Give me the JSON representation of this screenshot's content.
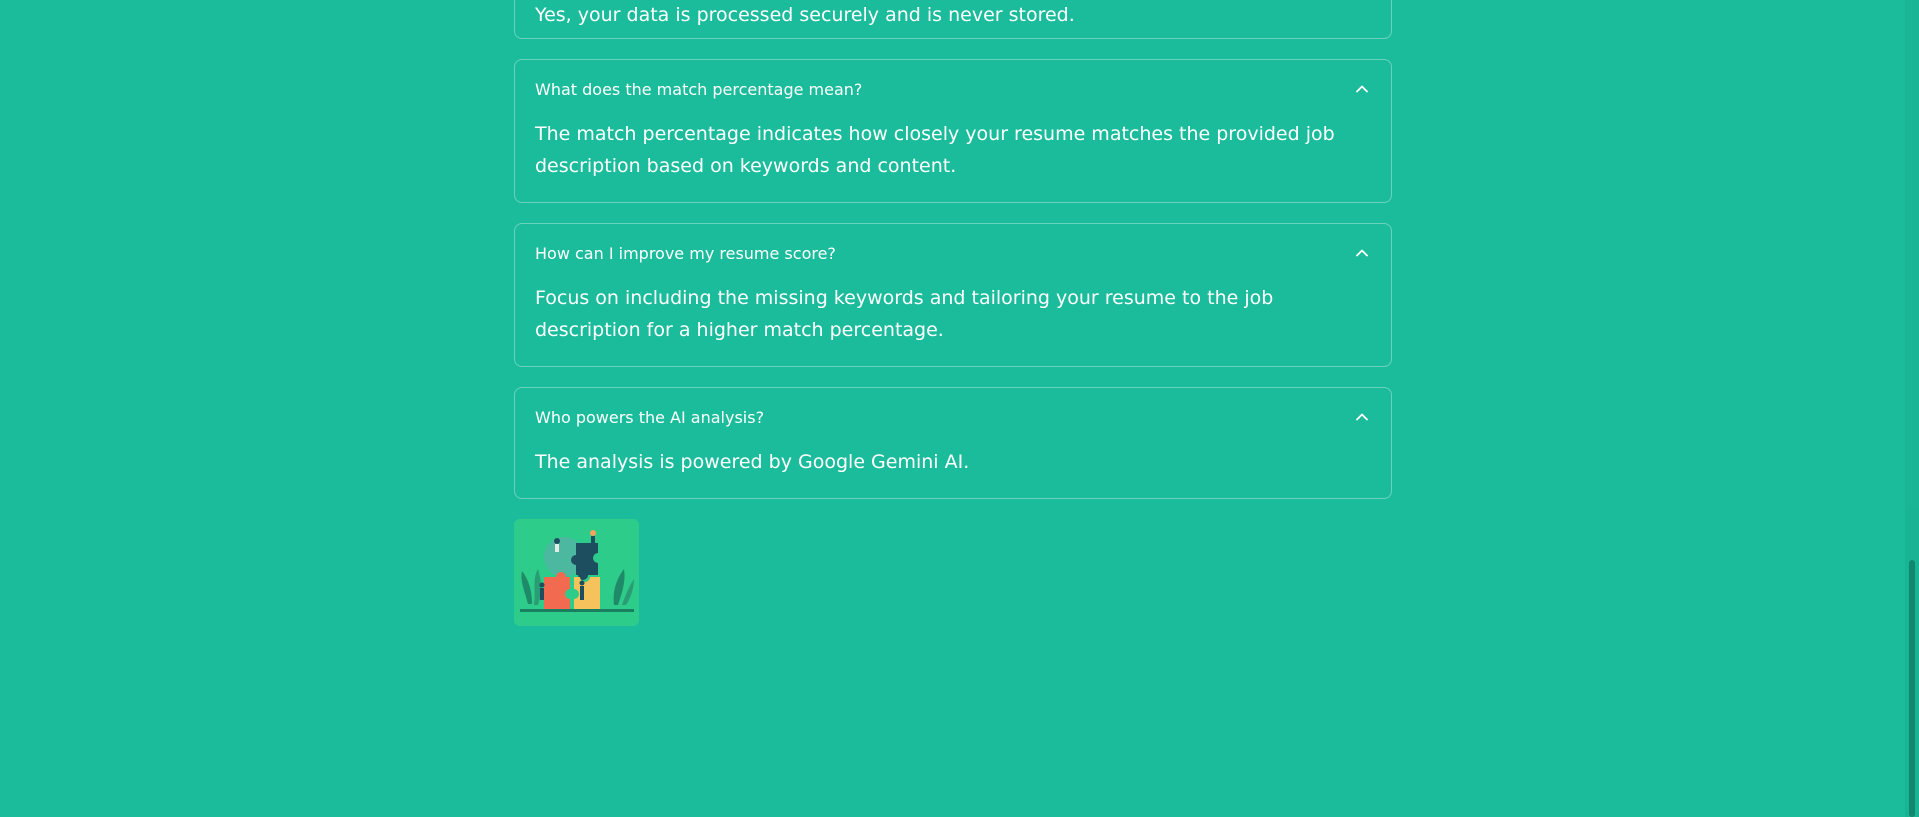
{
  "faqs": [
    {
      "question": "",
      "answer": "Yes, your data is processed securely and is never stored."
    },
    {
      "question": "What does the match percentage mean?",
      "answer": "The match percentage indicates how closely your resume matches the provided job description based on keywords and content."
    },
    {
      "question": "How can I improve my resume score?",
      "answer": "Focus on including the missing keywords and tailoring your resume to the job description for a higher match percentage."
    },
    {
      "question": "Who powers the AI analysis?",
      "answer": "The analysis is powered by Google Gemini AI."
    }
  ],
  "colors": {
    "background": "#1bbc9b",
    "text": "#ffffff",
    "image_tile": "#2ecc8a"
  },
  "icons": {
    "expanded_chevron": "chevron-up-icon",
    "illustration": "puzzle-teamwork-illustration"
  }
}
